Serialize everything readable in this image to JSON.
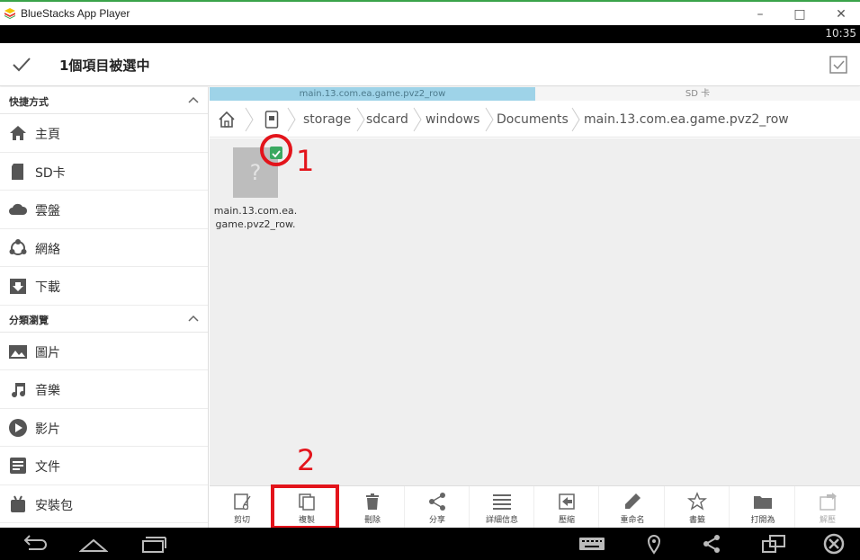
{
  "window": {
    "title": "BlueStacks App Player",
    "controls": [
      "minimize",
      "maximize",
      "close"
    ]
  },
  "statusbar": {
    "clock": "10:35"
  },
  "actionbar": {
    "selection_title": "1個項目被選中"
  },
  "sidebar": {
    "section1_label": "快捷方式",
    "items1": [
      {
        "label": "主頁",
        "icon": "home-icon"
      },
      {
        "label": "SD卡",
        "icon": "sdcard-icon"
      },
      {
        "label": "雲盤",
        "icon": "cloud-icon"
      },
      {
        "label": "網絡",
        "icon": "network-icon"
      },
      {
        "label": "下載",
        "icon": "download-icon"
      }
    ],
    "section2_label": "分類瀏覽",
    "items2": [
      {
        "label": "圖片",
        "icon": "image-icon"
      },
      {
        "label": "音樂",
        "icon": "music-icon"
      },
      {
        "label": "影片",
        "icon": "video-icon"
      },
      {
        "label": "文件",
        "icon": "document-icon"
      },
      {
        "label": "安裝包",
        "icon": "apk-icon"
      }
    ]
  },
  "tabs": [
    {
      "label": "main.13.com.ea.game.pvz2_row",
      "active": true
    },
    {
      "label": "SD 卡",
      "active": false
    }
  ],
  "breadcrumb": [
    "storage",
    "sdcard",
    "windows",
    "Documents",
    "main.13.com.ea.game.pvz2_row"
  ],
  "files": [
    {
      "name_line1": "main.13.com.ea.",
      "name_line2": "game.pvz2_row.",
      "thumb": "?",
      "selected": true
    }
  ],
  "annotations": {
    "one": "1",
    "two": "2"
  },
  "toolbar": [
    {
      "label": "剪切",
      "icon": "cut-icon"
    },
    {
      "label": "複製",
      "icon": "copy-icon"
    },
    {
      "label": "刪除",
      "icon": "delete-icon"
    },
    {
      "label": "分享",
      "icon": "share-icon"
    },
    {
      "label": "詳細信息",
      "icon": "details-icon"
    },
    {
      "label": "壓縮",
      "icon": "compress-icon"
    },
    {
      "label": "重命名",
      "icon": "rename-icon"
    },
    {
      "label": "書籤",
      "icon": "bookmark-icon"
    },
    {
      "label": "打開為",
      "icon": "open-as-icon"
    },
    {
      "label": "解壓",
      "icon": "extract-icon"
    }
  ],
  "colors": {
    "accent": "#9ed3e8",
    "check": "#3aa860",
    "annotation": "#e3141b"
  }
}
